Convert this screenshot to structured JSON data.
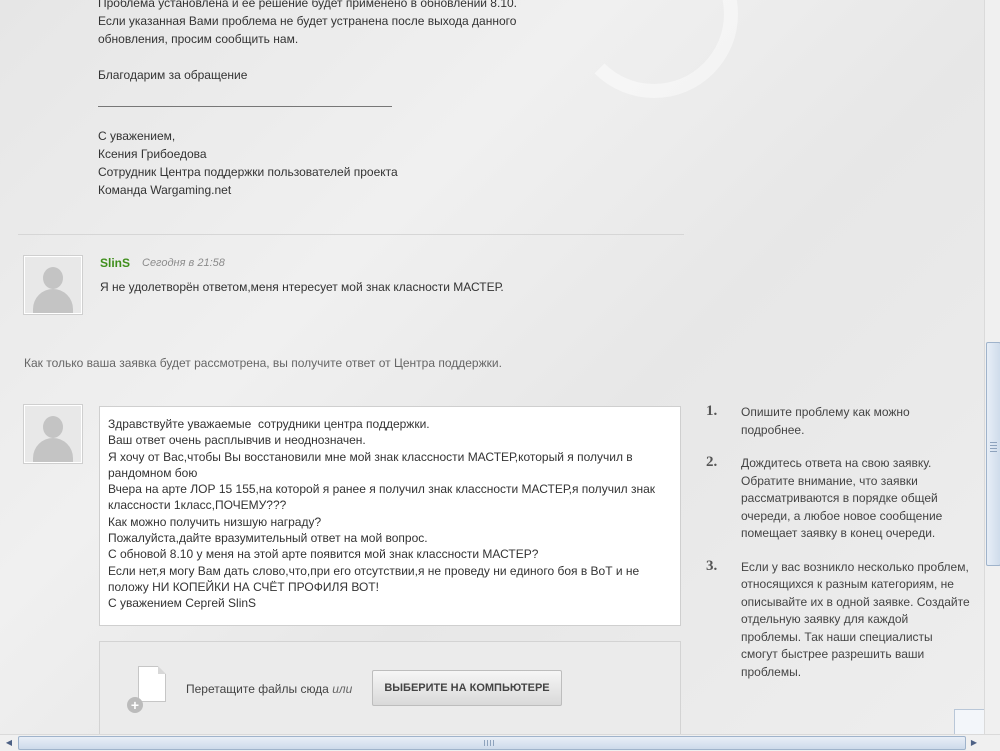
{
  "previous_message": {
    "lines": [
      "Проблема установлена и её решение будет применено в обновлении 8.10.",
      "Если указанная Вами проблема не будет устранена после выхода данного",
      "обновления, просим сообщить нам."
    ],
    "thanks": "Благодарим за обращение",
    "signature": [
      "С уважением,",
      "Ксения Грибоедова",
      "Сотрудник Центра поддержки пользователей проекта",
      "Команда Wargaming.net"
    ]
  },
  "comment": {
    "author": "SlinS",
    "time": "Сегодня в 21:58",
    "text": "Я не удолетворён ответом,меня нтересует мой знак класности МАСТЕР."
  },
  "notice": "Как только ваша заявка будет рассмотрена, вы получите ответ от Центра поддержки.",
  "reply": {
    "value": "Здравствуйте уважаемые  сотрудники центра поддержки.\nВаш ответ очень расплывчив и неоднозначен.\nЯ хочу от Вас,чтобы Вы восстановили мне мой знак классности МАСТЕР,который я получил в рандомном бою\nВчера на арте ЛОР 15 155,на которой я ранее я получил знак классности МАСТЕР,я получил знак классности 1класс,ПОЧЕМУ???\nКак можно получить низшую награду?\nПожалуйста,дайте вразумительный ответ на мой вопрос.\nС обновой 8.10 у меня на этой арте появится мой знак классности МАСТЕР?\nЕсли нет,я могу Вам дать слово,что,при его отсутствии,я не проведу ни единого боя в ВоТ и не положу НИ КОПЕЙКИ НА СЧЁТ ПРОФИЛЯ ВОТ!\nС уважением Сергей SlinS"
  },
  "upload": {
    "drop_text": "Перетащите файлы сюда",
    "or_text": "или",
    "button_label": "ВЫБЕРИТЕ НА КОМПЬЮТЕРЕ"
  },
  "tips": [
    {
      "num": "1.",
      "text": "Опишите проблему как можно подробнее."
    },
    {
      "num": "2.",
      "text": "Дождитесь ответа на свою заявку. Обратите внимание, что заявки рассматриваются в порядке общей очереди, а любое новое сообщение помещает заявку в конец очереди."
    },
    {
      "num": "3.",
      "text": "Если у вас возникло несколько проблем, относящихся к разным категориям, не описывайте их в одной заявке. Создайте отдельную заявку для каждой проблемы. Так наши специалисты смогут быстрее разрешить ваши проблемы."
    }
  ],
  "colors": {
    "author": "#3f8e1c",
    "scroll_accent": "#9fb3cb"
  },
  "icons": {
    "avatar": "user-silhouette-icon",
    "file": "file-icon",
    "plus": "plus-icon",
    "scroll_left": "arrow-left-icon",
    "scroll_right": "arrow-right-icon"
  }
}
